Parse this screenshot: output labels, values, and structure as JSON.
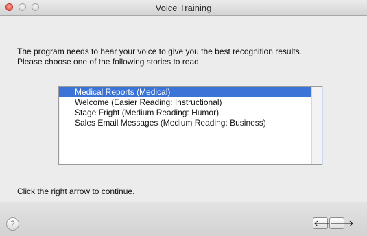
{
  "window": {
    "title": "Voice Training"
  },
  "instructions": {
    "line1": "The program needs to hear your voice to give you the best recognition results.",
    "line2": "Please choose one of the following stories to read."
  },
  "stories": {
    "items": [
      "Medical Reports (Medical)",
      "Welcome (Easier Reading: Instructional)",
      "Stage Fright (Medium Reading: Humor)",
      "Sales Email Messages (Medium Reading: Business)"
    ],
    "selected_index": 0
  },
  "footer": {
    "continue_text": "Click the right arrow to continue.",
    "help_label": "?",
    "back_glyph": "🡐",
    "next_glyph": "🡒"
  },
  "icons": {
    "back": "left-arrow-icon",
    "next": "right-arrow-icon",
    "help": "question-mark-icon"
  },
  "colors": {
    "selection": "#3b74d6",
    "window_bg": "#ececec"
  }
}
